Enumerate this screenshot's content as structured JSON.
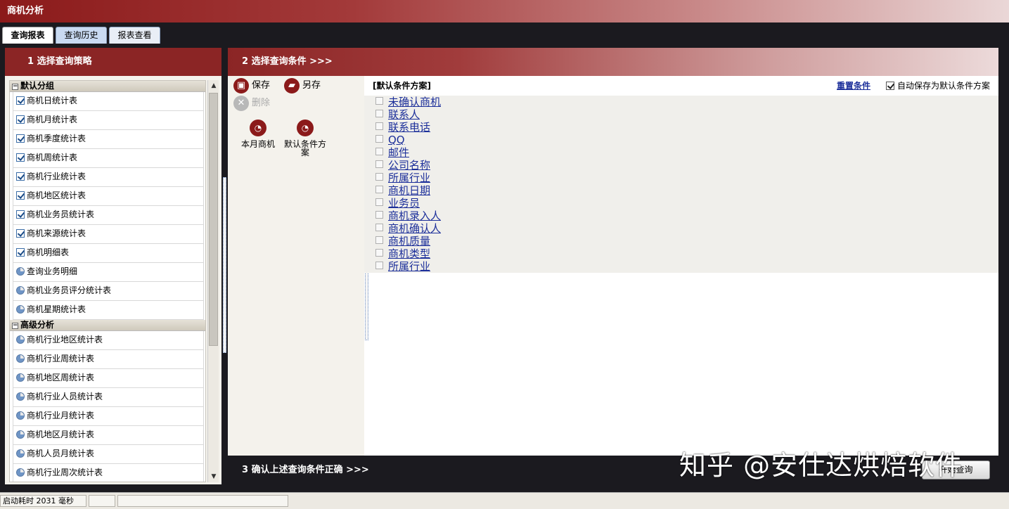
{
  "window": {
    "title": "商机分析"
  },
  "tabs": [
    {
      "label": "查询报表",
      "active": true
    },
    {
      "label": "查询历史",
      "active": false
    },
    {
      "label": "报表查看",
      "active": false
    }
  ],
  "step1": {
    "header": "1  选择查询策略",
    "groups": [
      {
        "title": "默认分组",
        "items": [
          {
            "label": "商机日统计表",
            "icon": "check-icon"
          },
          {
            "label": "商机月统计表",
            "icon": "check-icon"
          },
          {
            "label": "商机季度统计表",
            "icon": "check-icon"
          },
          {
            "label": "商机周统计表",
            "icon": "check-icon"
          },
          {
            "label": "商机行业统计表",
            "icon": "check-icon"
          },
          {
            "label": "商机地区统计表",
            "icon": "check-icon"
          },
          {
            "label": "商机业务员统计表",
            "icon": "check-icon"
          },
          {
            "label": "商机来源统计表",
            "icon": "check-icon"
          },
          {
            "label": "商机明细表",
            "icon": "check-icon"
          },
          {
            "label": "查询业务明细",
            "icon": "pie-icon"
          },
          {
            "label": "商机业务员评分统计表",
            "icon": "pie-icon"
          },
          {
            "label": "商机星期统计表",
            "icon": "pie-icon"
          }
        ]
      },
      {
        "title": "高级分析",
        "items": [
          {
            "label": "商机行业地区统计表",
            "icon": "pie-icon"
          },
          {
            "label": "商机行业周统计表",
            "icon": "pie-icon"
          },
          {
            "label": "商机地区周统计表",
            "icon": "pie-icon"
          },
          {
            "label": "商机行业人员统计表",
            "icon": "pie-icon"
          },
          {
            "label": "商机行业月统计表",
            "icon": "pie-icon"
          },
          {
            "label": "商机地区月统计表",
            "icon": "pie-icon"
          },
          {
            "label": "商机人员月统计表",
            "icon": "pie-icon"
          },
          {
            "label": "商机行业周次统计表",
            "icon": "pie-icon"
          }
        ]
      }
    ]
  },
  "step2": {
    "header": "2  选择查询条件  >>>",
    "toolbar": {
      "save": "保存",
      "save_as": "另存",
      "delete": "删除"
    },
    "schemes": [
      "本月商机",
      "默认条件方案"
    ],
    "scheme_title": "[默认条件方案]",
    "reset_label": "重置条件",
    "autosave_label": "自动保存为默认条件方案",
    "autosave_checked": true,
    "conditions": [
      "未确认商机",
      "联系人",
      "联系电话",
      "QQ",
      "邮件",
      "公司名称",
      "所属行业",
      "商机日期",
      "业务员",
      "商机录入人",
      "商机确认人",
      "商机质量",
      "商机类型",
      "所属行业"
    ]
  },
  "step3": {
    "header": "3  确认上述查询条件正确  >>>",
    "start_button": "开始查询"
  },
  "watermark": "知乎 @安仕达烘焙软件",
  "status": {
    "startup_time": "启动耗时 2031 毫秒"
  }
}
